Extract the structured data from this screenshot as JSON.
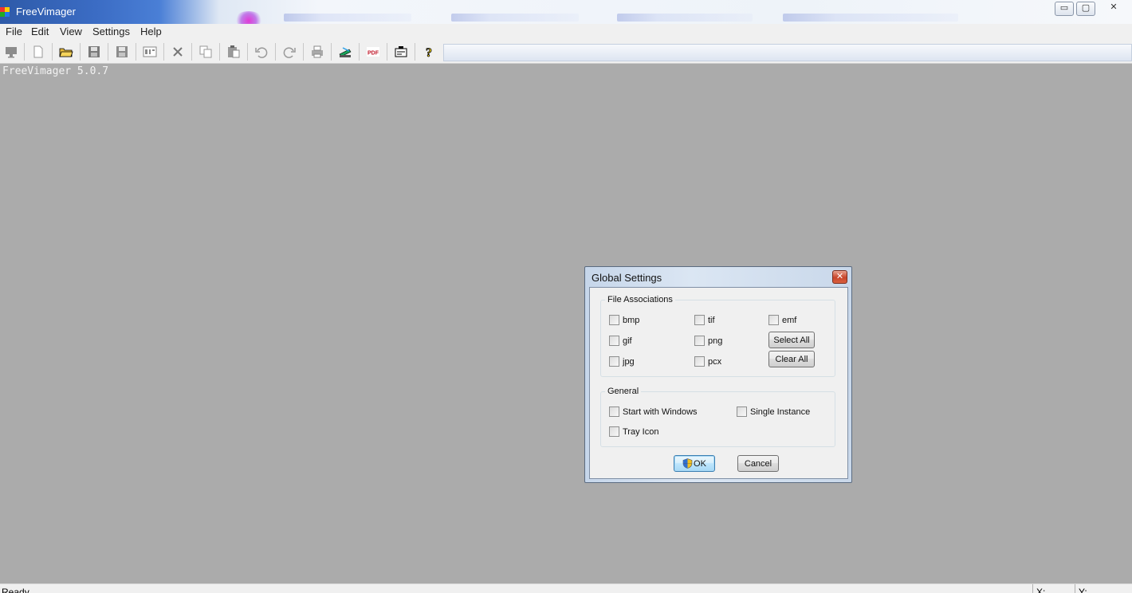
{
  "window": {
    "title": "FreeVimager",
    "controls": {
      "minimize": "▭",
      "maximize": "▢",
      "close": "✕"
    }
  },
  "menu": [
    "File",
    "Edit",
    "View",
    "Settings",
    "Help"
  ],
  "toolbar": {
    "buttons": [
      "monitor",
      "new",
      "open",
      "save",
      "save-as",
      "iptc",
      "delete",
      "copy",
      "paste",
      "undo",
      "redo",
      "print",
      "scan",
      "pdf",
      "email",
      "help"
    ],
    "pdf_label": "PDF",
    "help_label": "?"
  },
  "workspace": {
    "version_text": "FreeVimager 5.0.7"
  },
  "status": {
    "text": "Ready",
    "x_label": "X:",
    "y_label": "Y:"
  },
  "dialog": {
    "title": "Global Settings",
    "close_label": "✕",
    "file_associations": {
      "legend": "File Associations",
      "items": [
        "bmp",
        "tif",
        "emf",
        "gif",
        "png",
        "jpg",
        "pcx"
      ],
      "select_all": "Select All",
      "clear_all": "Clear All"
    },
    "general": {
      "legend": "General",
      "start_with_windows": "Start with Windows",
      "single_instance": "Single Instance",
      "tray_icon": "Tray Icon"
    },
    "ok": "OK",
    "cancel": "Cancel"
  }
}
